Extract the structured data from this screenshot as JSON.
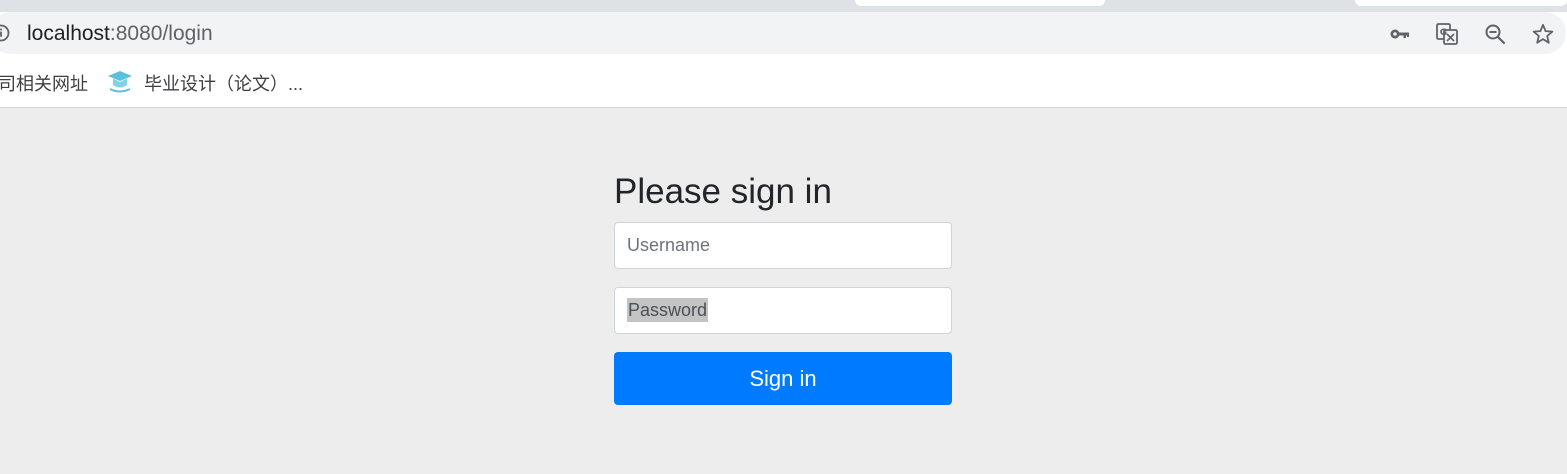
{
  "browser": {
    "url_host": "localhost",
    "url_path": ":8080/login",
    "icons": [
      "info-icon",
      "key-icon",
      "translate-icon",
      "zoom-out-icon",
      "star-icon"
    ]
  },
  "bookmarks": {
    "items": [
      {
        "label": "司相关网址"
      },
      {
        "label": "毕业设计（论文）...",
        "icon": "graduation-cap-icon"
      }
    ]
  },
  "login": {
    "heading": "Please sign in",
    "username_placeholder": "Username",
    "password_placeholder": "Password",
    "submit_label": "Sign in",
    "accent_color": "#007bff"
  }
}
